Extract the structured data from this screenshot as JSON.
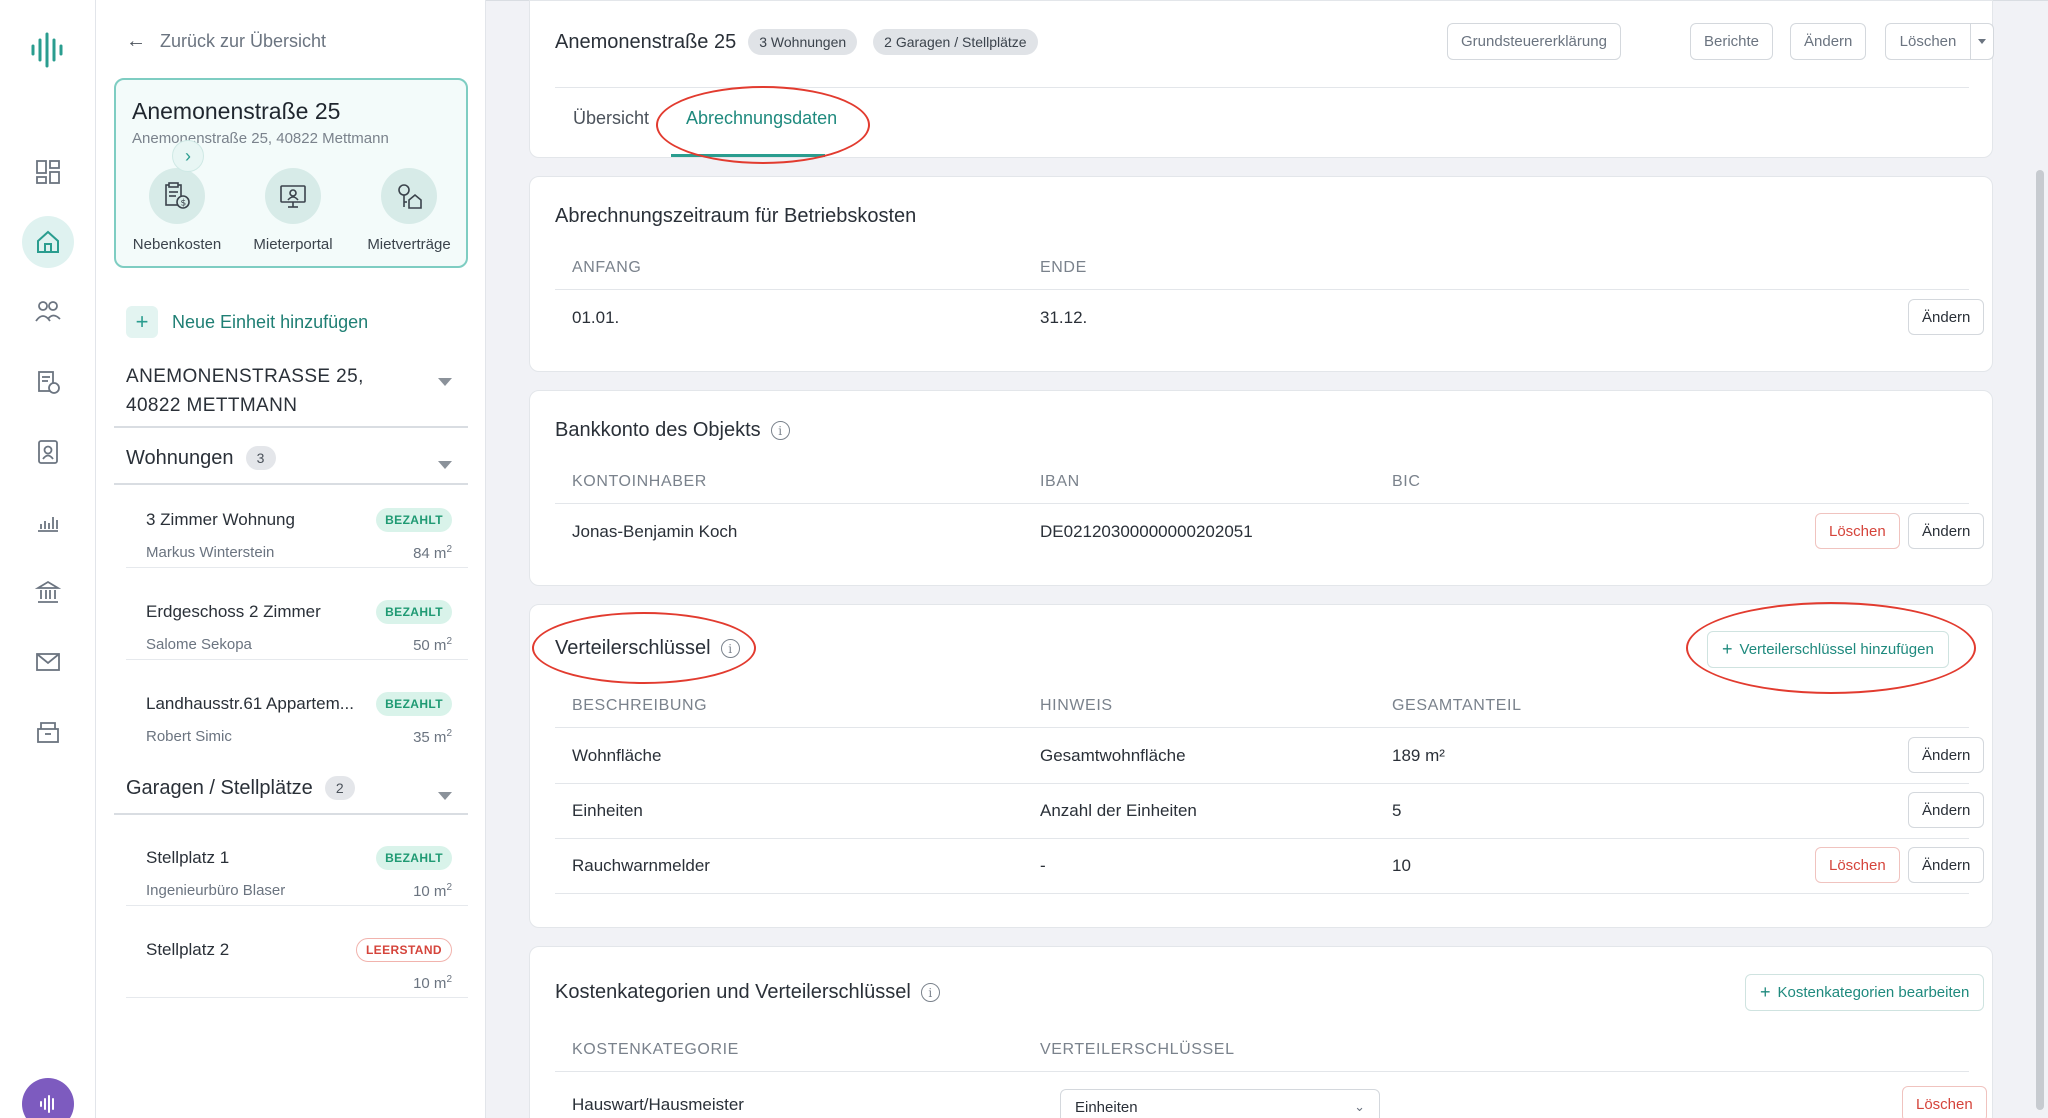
{
  "sidebar": {
    "back_label": "Zurück zur Übersicht",
    "property": {
      "title": "Anemonenstraße 25",
      "address": "Anemonenstraße 25, 40822 Mettmann",
      "actions": [
        {
          "label": "Nebenkosten",
          "icon": "receipt-money-icon"
        },
        {
          "label": "Mieterportal",
          "icon": "monitor-icon"
        },
        {
          "label": "Mietverträge",
          "icon": "keys-house-icon"
        }
      ]
    },
    "add_unit_label": "Neue Einheit hinzufügen",
    "address_heading_line1": "ANEMONENSTRASSE 25,",
    "address_heading_line2": "40822 METTMANN",
    "apartments": {
      "heading": "Wohnungen",
      "count": "3",
      "items": [
        {
          "name": "3 Zimmer Wohnung",
          "tenant": "Markus Winterstein",
          "area": "84 m",
          "status": "BEZAHLT"
        },
        {
          "name": "Erdgeschoss 2 Zimmer",
          "tenant": "Salome Sekopa",
          "area": "50 m",
          "status": "BEZAHLT"
        },
        {
          "name": "Landhausstr.61 Appartem...",
          "tenant": "Robert Simic",
          "area": "35 m",
          "status": "BEZAHLT"
        }
      ]
    },
    "garages": {
      "heading": "Garagen / Stellplätze",
      "count": "2",
      "items": [
        {
          "name": "Stellplatz 1",
          "tenant": "Ingenieurbüro Blaser",
          "area": "10 m",
          "status": "BEZAHLT"
        },
        {
          "name": "Stellplatz 2",
          "tenant": "",
          "area": "10 m",
          "status": "LEERSTAND"
        }
      ]
    },
    "area_unit_sup": "2"
  },
  "header": {
    "title": "Anemonenstraße 25",
    "chip_apartments": "3 Wohnungen",
    "chip_garages": "2 Garagen / Stellplätze",
    "buttons": {
      "tax": "Grundsteuererklärung",
      "reports": "Berichte",
      "edit": "Ändern",
      "delete": "Löschen"
    },
    "tabs": [
      {
        "label": "Übersicht",
        "active": false
      },
      {
        "label": "Abrechnungsdaten",
        "active": true
      }
    ]
  },
  "billing_period": {
    "title": "Abrechnungszeitraum für Betriebskosten",
    "col_start": "ANFANG",
    "col_end": "ENDE",
    "start": "01.01.",
    "end": "31.12.",
    "edit": "Ändern"
  },
  "bank": {
    "title": "Bankkonto des Objekts",
    "col_holder": "KONTOINHABER",
    "col_iban": "IBAN",
    "col_bic": "BIC",
    "holder": "Jonas-Benjamin Koch",
    "iban": "DE02120300000000202051",
    "bic": "",
    "delete": "Löschen",
    "edit": "Ändern"
  },
  "keys": {
    "title": "Verteilerschlüssel",
    "add_label": "Verteilerschlüssel hinzufügen",
    "col_desc": "BESCHREIBUNG",
    "col_hint": "HINWEIS",
    "col_total": "GESAMTANTEIL",
    "rows": [
      {
        "desc": "Wohnfläche",
        "hint": "Gesamtwohnfläche",
        "total": "189 m²",
        "deletable": false
      },
      {
        "desc": "Einheiten",
        "hint": "Anzahl der Einheiten",
        "total": "5",
        "deletable": false
      },
      {
        "desc": "Rauchwarnmelder",
        "hint": "-",
        "total": "10",
        "deletable": true
      }
    ],
    "delete": "Löschen",
    "edit": "Ändern"
  },
  "cost_categories": {
    "title": "Kostenkategorien und Verteilerschlüssel",
    "edit_label": "Kostenkategorien bearbeiten",
    "col_category": "KOSTENKATEGORIE",
    "col_key": "VERTEILERSCHLÜSSEL",
    "rows": [
      {
        "category": "Hauswart/Hausmeister",
        "key": "Einheiten"
      }
    ],
    "delete": "Löschen"
  },
  "colors": {
    "accent": "#2a9d8f",
    "danger": "#d5443b",
    "annotation": "#e23b2f"
  }
}
